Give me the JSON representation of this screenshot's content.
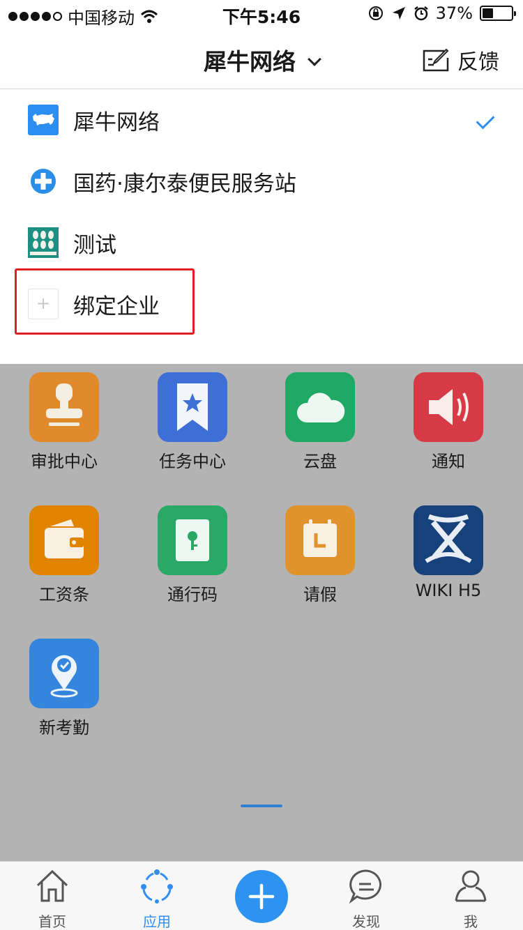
{
  "status_bar": {
    "carrier": "中国移动",
    "time": "下午5:46",
    "battery_text": "37%",
    "battery_level": 0.37
  },
  "nav": {
    "title": "犀牛网络",
    "feedback_label": "反馈"
  },
  "dropdown": {
    "items": [
      {
        "name": "犀牛网络",
        "icon": "rhino-icon",
        "selected": true
      },
      {
        "name": "国药·康尔泰便民服务站",
        "icon": "medical-cross-icon",
        "selected": false
      },
      {
        "name": "测试",
        "icon": "pattern-icon",
        "selected": false
      }
    ],
    "bind_label": "绑定企业"
  },
  "apps": [
    {
      "label": "审批中心",
      "icon": "stamp-icon",
      "color": "#e08a2c"
    },
    {
      "label": "任务中心",
      "icon": "bookmark-star-icon",
      "color": "#3d6fd6"
    },
    {
      "label": "云盘",
      "icon": "cloud-icon",
      "color": "#20a865"
    },
    {
      "label": "通知",
      "icon": "speaker-icon",
      "color": "#d63b45"
    },
    {
      "label": "工资条",
      "icon": "wallet-icon",
      "color": "#e08400"
    },
    {
      "label": "通行码",
      "icon": "lock-key-icon",
      "color": "#2aa866"
    },
    {
      "label": "请假",
      "icon": "calendar-icon",
      "color": "#e0922c"
    },
    {
      "label": "WIKI H5",
      "icon": "confluence-icon",
      "color": "#17417a"
    },
    {
      "label": "新考勤",
      "icon": "location-check-icon",
      "color": "#3386db"
    }
  ],
  "tabs": [
    {
      "label": "首页",
      "icon": "home-icon",
      "active": false
    },
    {
      "label": "应用",
      "icon": "apps-circle-icon",
      "active": true
    },
    {
      "label": "",
      "icon": "plus-icon",
      "active": false
    },
    {
      "label": "发现",
      "icon": "chat-bubble-icon",
      "active": false
    },
    {
      "label": "我",
      "icon": "person-icon",
      "active": false
    }
  ],
  "colors": {
    "accent": "#2d92f0",
    "highlight_border": "#e0201e",
    "overlay": "#b3b3b3"
  }
}
